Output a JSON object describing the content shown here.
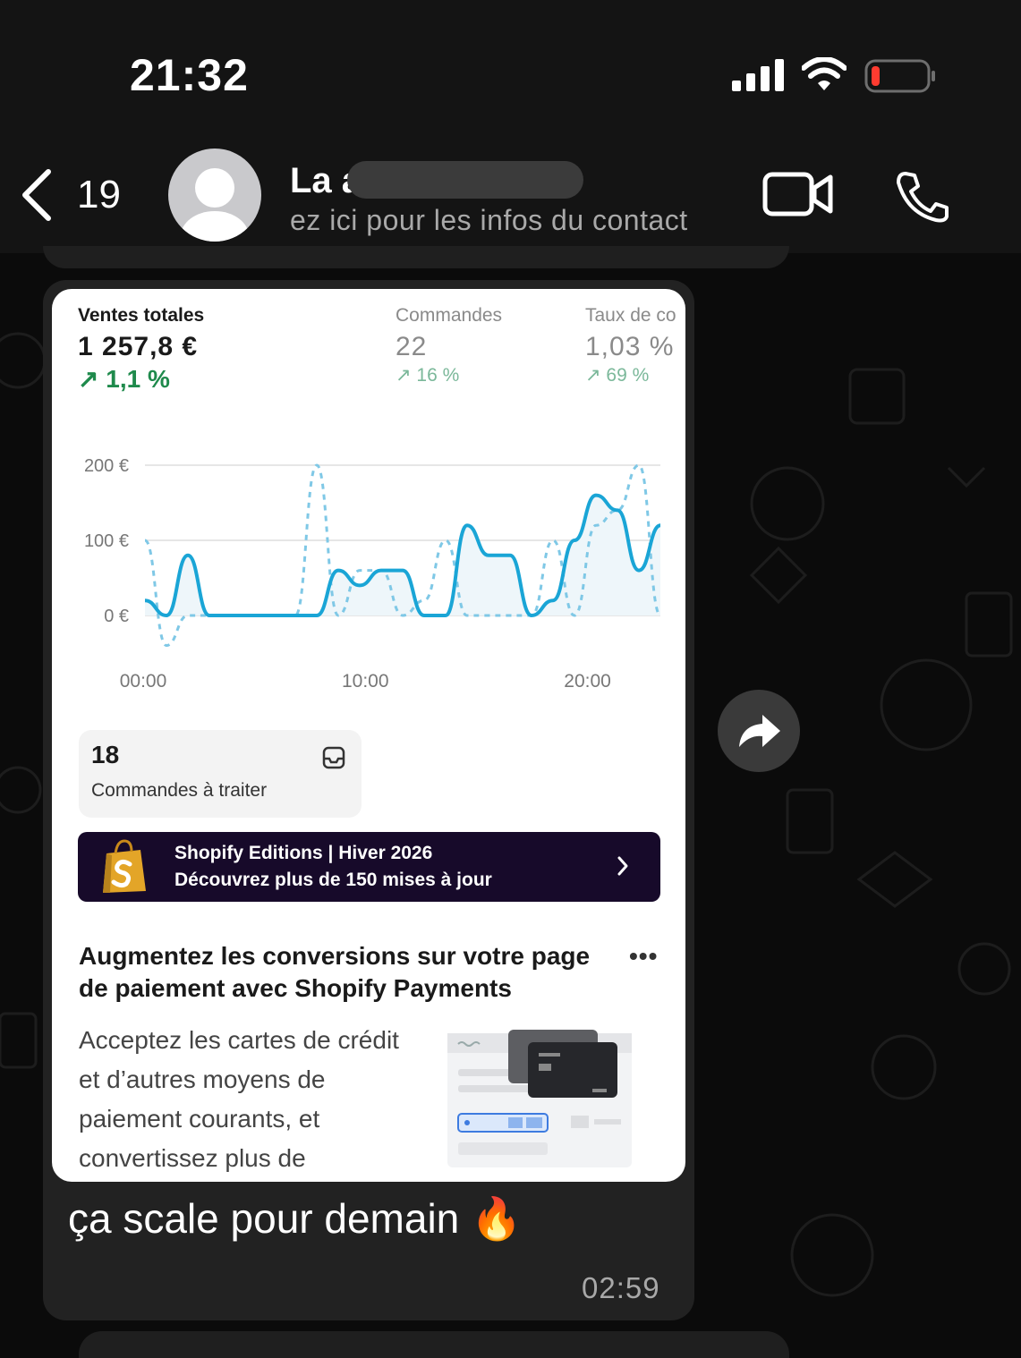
{
  "status_bar": {
    "time": "21:32"
  },
  "header": {
    "back_count": "19",
    "contact_name": "La                a",
    "contact_subtitle": "ez ici pour les infos du contact"
  },
  "screenshot": {
    "kpis": [
      {
        "label": "Ventes totales",
        "value": "1 257,8 €",
        "change": "↗ 1,1 %"
      },
      {
        "label": "Commandes",
        "value": "22",
        "change": "↗ 16 %"
      },
      {
        "label": "Taux de co",
        "value": "1,03 %",
        "change": "↗ 69 %"
      }
    ],
    "chart_data": {
      "type": "line",
      "x": [
        "00:00",
        "01:00",
        "02:00",
        "03:00",
        "04:00",
        "05:00",
        "06:00",
        "07:00",
        "08:00",
        "09:00",
        "10:00",
        "11:00",
        "12:00",
        "13:00",
        "14:00",
        "15:00",
        "16:00",
        "17:00",
        "18:00",
        "19:00",
        "20:00",
        "21:00",
        "22:00",
        "23:00"
      ],
      "x_ticks": [
        "00:00",
        "10:00",
        "20:00"
      ],
      "y_ticks": [
        "200 €",
        "100 €",
        "0 €"
      ],
      "ylim": [
        -40,
        200
      ],
      "series": [
        {
          "style": "solid",
          "values": [
            20,
            0,
            80,
            0,
            0,
            0,
            0,
            0,
            0,
            60,
            40,
            60,
            60,
            0,
            0,
            120,
            80,
            80,
            0,
            20,
            100,
            160,
            140,
            60,
            120
          ]
        },
        {
          "style": "dashed",
          "values": [
            100,
            -40,
            0,
            0,
            0,
            0,
            0,
            0,
            200,
            0,
            60,
            60,
            0,
            20,
            100,
            0,
            0,
            0,
            0,
            100,
            0,
            120,
            140,
            200,
            0
          ]
        }
      ],
      "colors": {
        "solid": "#1aa5d6",
        "dashed": "#7fc8e6"
      }
    },
    "orders": {
      "count": "18",
      "label": "Commandes à traiter"
    },
    "banner": {
      "title": "Shopify Editions | Hiver 2026",
      "subtitle": "Découvrez plus de 150 mises à jour"
    },
    "promo": {
      "title": "Augmentez les conversions sur votre page de paiement avec Shopify Payments",
      "more": "•••",
      "body": "Acceptez les cartes de crédit et d’autres moyens de paiement courants, et convertissez plus de"
    }
  },
  "message": {
    "text": "ça scale pour demain 🔥",
    "time": "02:59"
  },
  "colors": {
    "bubble": "#222222",
    "header": "#141414",
    "accent_green": "#1f8a4c",
    "banner_bg": "#170a2a"
  }
}
